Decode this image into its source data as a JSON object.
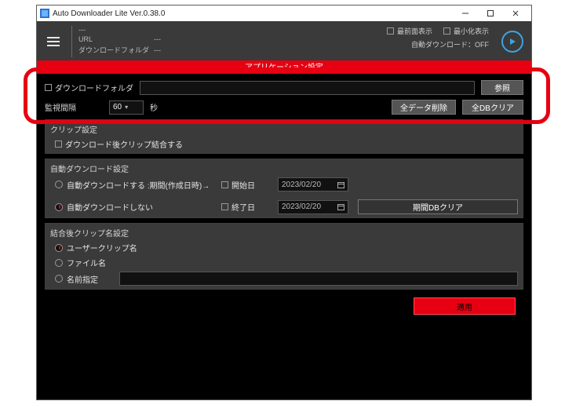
{
  "window": {
    "title": "Auto Downloader Lite Ver.0.38.0",
    "controlsTooltips": {
      "min": "Minimize",
      "max": "Maximize",
      "close": "Close"
    }
  },
  "topbar": {
    "status": {
      "dashes": "---",
      "url_label": "URL",
      "url_value": "---",
      "dlfolder_label": "ダウンロードフォルダ",
      "dlfolder_value": "---"
    },
    "options": {
      "topmost": "最前面表示",
      "minview": "最小化表示",
      "autodl": "自動ダウンロード：OFF"
    }
  },
  "section_title": "アプリケーション設定",
  "settings": {
    "dlfolder_label": "ダウンロードフォルダ",
    "dlfolder_value": "",
    "browse_btn": "参照",
    "interval_label": "監視間隔",
    "interval_value": "60",
    "interval_unit": "秒",
    "delete_all_btn": "全データ削除",
    "clear_alldb_btn": "全DBクリア"
  },
  "clip": {
    "panel_title": "クリップ設定",
    "merge_after_dl": "ダウンロード後クリップ結合する"
  },
  "autodl": {
    "panel_title": "自動ダウンロード設定",
    "opt_do": "自動ダウンロードする :期間(作成日時)→",
    "opt_dont": "自動ダウンロードしない",
    "start_label": "開始日",
    "end_label": "終了日",
    "start_date": "2023/02/20",
    "end_date": "2023/02/20",
    "period_clear_btn": "期間DBクリア"
  },
  "clipname": {
    "panel_title": "結合後クリップ名設定",
    "opt_user": "ユーザークリップ名",
    "opt_file": "ファイル名",
    "opt_custom": "名前指定",
    "custom_value": ""
  },
  "apply_btn": "適用",
  "highlight_note": "highlighted-region"
}
